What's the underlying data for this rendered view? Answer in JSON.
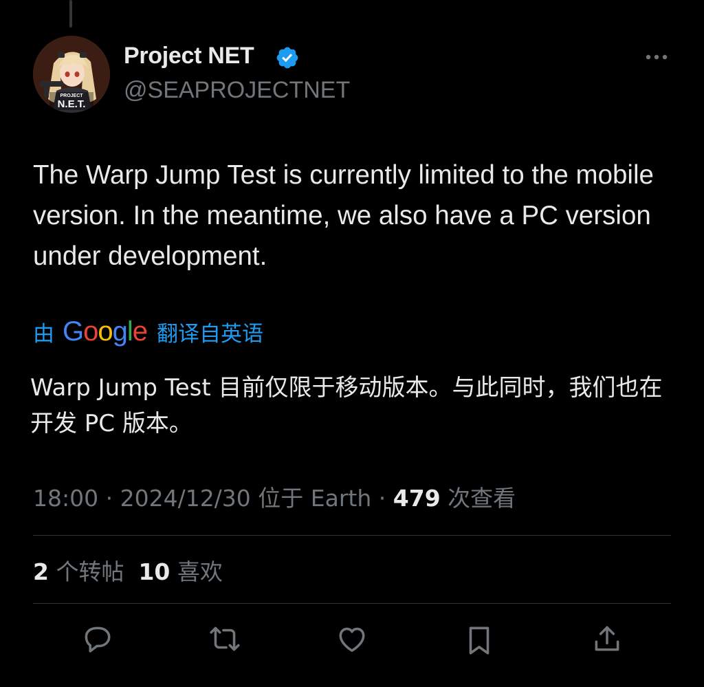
{
  "author": {
    "name": "Project NET",
    "handle": "@SEAPROJECTNET",
    "avatar_badge_top": "PROJECT",
    "avatar_badge_main": "N.E.T.",
    "avatar_icon": "avatar-image",
    "verified_icon": "verified-badge-icon",
    "more_icon": "more-options-icon"
  },
  "tweet": {
    "text": "The Warp Jump Test is currently limited to the mobile version. In the meantime, we also have a PC version under development."
  },
  "translation": {
    "prefix": "由",
    "provider": "Google",
    "suffix": "翻译自英语",
    "text": "Warp Jump Test 目前仅限于移动版本。与此同时，我们也在开发 PC 版本。"
  },
  "meta": {
    "time": "18:00",
    "separator": " · ",
    "date": "2024/12/30",
    "location": "位于 Earth",
    "views": "479",
    "views_label": "次查看"
  },
  "stats": {
    "reposts_count": "2",
    "reposts_label": "个转帖",
    "likes_count": "10",
    "likes_label": "喜欢"
  },
  "actions": [
    {
      "icon": "reply-icon"
    },
    {
      "icon": "repost-icon"
    },
    {
      "icon": "like-icon"
    },
    {
      "icon": "bookmark-icon"
    },
    {
      "icon": "share-icon"
    }
  ],
  "colors": {
    "background": "#000000",
    "text_primary": "#e7e9ea",
    "text_secondary": "#71767b",
    "accent_blue": "#1d9bf0",
    "divider": "#2f3336",
    "google_blue": "#4285f4",
    "google_red": "#ea4335",
    "google_yellow": "#fbbc05",
    "google_green": "#34a853"
  }
}
